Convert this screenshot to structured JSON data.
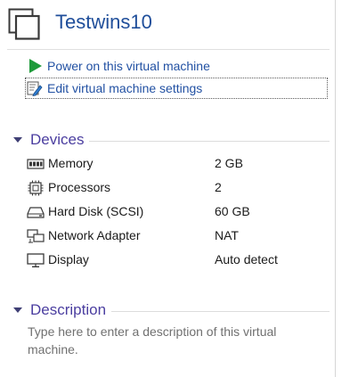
{
  "vm": {
    "title": "Testwins10"
  },
  "actions": {
    "power_on": "Power on this virtual machine",
    "edit_settings": "Edit virtual machine settings"
  },
  "devices": {
    "title": "Devices",
    "items": [
      {
        "name": "Memory",
        "value": "2 GB",
        "icon": "memory-icon"
      },
      {
        "name": "Processors",
        "value": "2",
        "icon": "processor-icon"
      },
      {
        "name": "Hard Disk (SCSI)",
        "value": "60 GB",
        "icon": "hard-disk-icon"
      },
      {
        "name": "Network Adapter",
        "value": "NAT",
        "icon": "network-adapter-icon"
      },
      {
        "name": "Display",
        "value": "Auto detect",
        "icon": "display-icon"
      }
    ]
  },
  "description": {
    "title": "Description",
    "placeholder": "Type here to enter a description of this virtual machine."
  },
  "colors": {
    "title_blue": "#1f4e9a",
    "link_blue": "#2251a3",
    "section_purple": "#4b3ea0",
    "play_green": "#1e9a3a",
    "placeholder_gray": "#707070"
  }
}
